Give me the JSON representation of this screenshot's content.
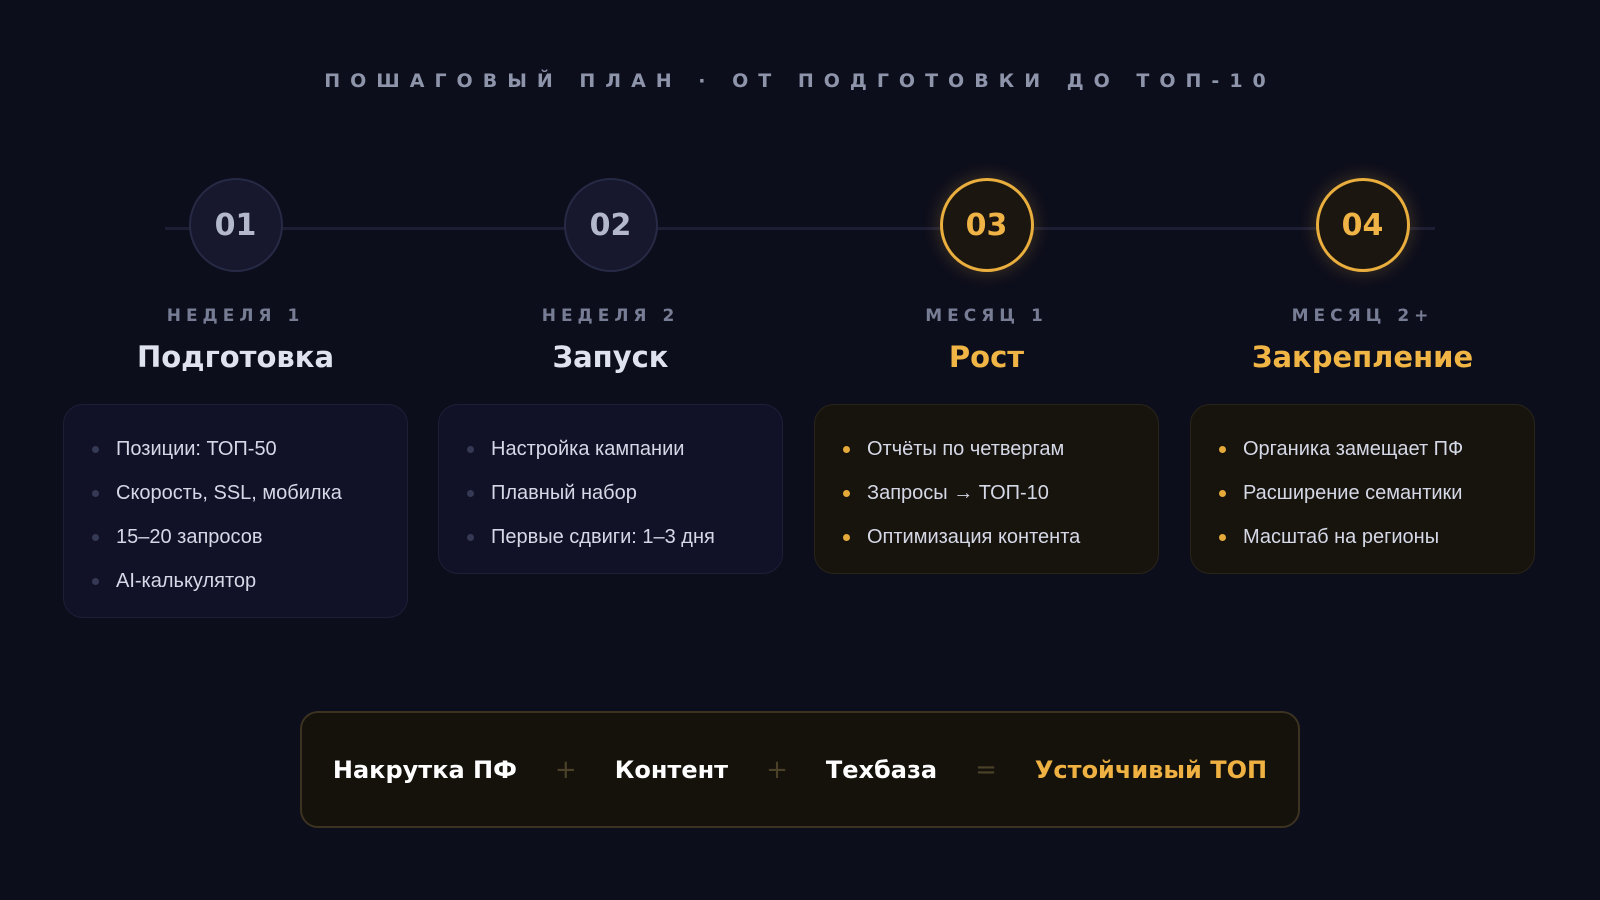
{
  "header": {
    "title": "ПОШАГОВЫЙ ПЛАН · ОТ ПОДГОТОВКИ ДО ТОП-10"
  },
  "steps": [
    {
      "number": "01",
      "period": "НЕДЕЛЯ 1",
      "title": "Подготовка",
      "highlighted": false,
      "items": [
        "Позиции: ТОП-50",
        "Скорость, SSL, мобилка",
        "15–20 запросов",
        "AI-калькулятор"
      ]
    },
    {
      "number": "02",
      "period": "НЕДЕЛЯ 2",
      "title": "Запуск",
      "highlighted": false,
      "items": [
        "Настройка кампании",
        "Плавный набор",
        "Первые сдвиги: 1–3 дня"
      ]
    },
    {
      "number": "03",
      "period": "МЕСЯЦ 1",
      "title": "Рост",
      "highlighted": true,
      "items": [
        "Отчёты по четвергам",
        "Запросы → ТОП-10",
        "Оптимизация контента"
      ]
    },
    {
      "number": "04",
      "period": "МЕСЯЦ 2+",
      "title": "Закрепление",
      "highlighted": true,
      "items": [
        "Органика замещает ПФ",
        "Расширение семантики",
        "Масштаб на регионы"
      ]
    }
  ],
  "formula": {
    "term1": "Накрутка ПФ",
    "op1": "+",
    "term2": "Контент",
    "op2": "+",
    "term3": "Техбаза",
    "op3": "=",
    "result": "Устойчивый ТОП"
  },
  "colors": {
    "background": "#0d0e1c",
    "accent": "#f1b545",
    "muted_text": "#8e95ab"
  }
}
